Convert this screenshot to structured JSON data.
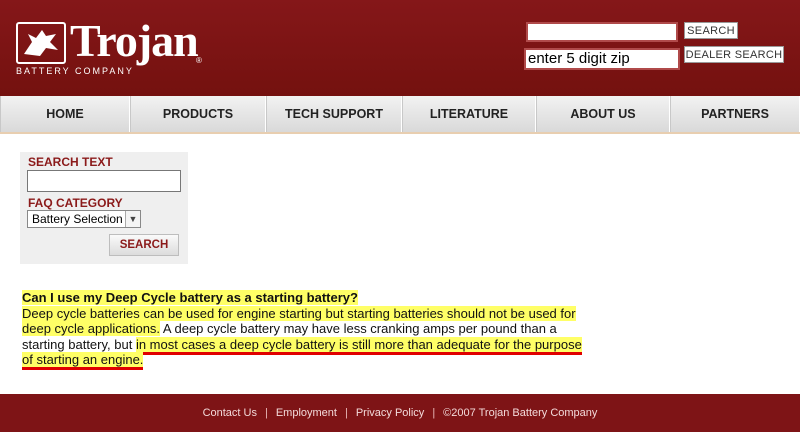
{
  "header": {
    "logo_text": "Trojan",
    "logo_subtitle": "BATTERY COMPANY",
    "search_button": "SEARCH",
    "zip_value": "enter 5 digit zip",
    "dealer_button": "DEALER SEARCH"
  },
  "nav": {
    "items": [
      "HOME",
      "PRODUCTS",
      "TECH SUPPORT",
      "LITERATURE",
      "ABOUT US",
      "PARTNERS"
    ]
  },
  "faq_search": {
    "search_label": "SEARCH TEXT",
    "search_value": "",
    "category_label": "FAQ CATEGORY",
    "category_selected": "Battery Selection",
    "submit_label": "SEARCH"
  },
  "faq": {
    "question": "Can I use my Deep Cycle battery as a starting battery?",
    "answer_part1": "Deep cycle batteries can be used for engine starting but starting batteries should not be used for deep cycle applications.",
    "answer_part2": " A deep cycle battery may have less cranking amps per pound than a starting battery, but ",
    "answer_part3": "in most cases ",
    "answer_part4": "a deep cycle battery is still more than adequate for the purpose of starting an engine."
  },
  "footer": {
    "links": [
      "Contact Us",
      "Employment",
      "Privacy Policy"
    ],
    "copyright": "©2007 Trojan Battery Company"
  },
  "colors": {
    "brand_red": "#7e1416",
    "highlight": "#ffff66",
    "underline": "#e00000"
  }
}
